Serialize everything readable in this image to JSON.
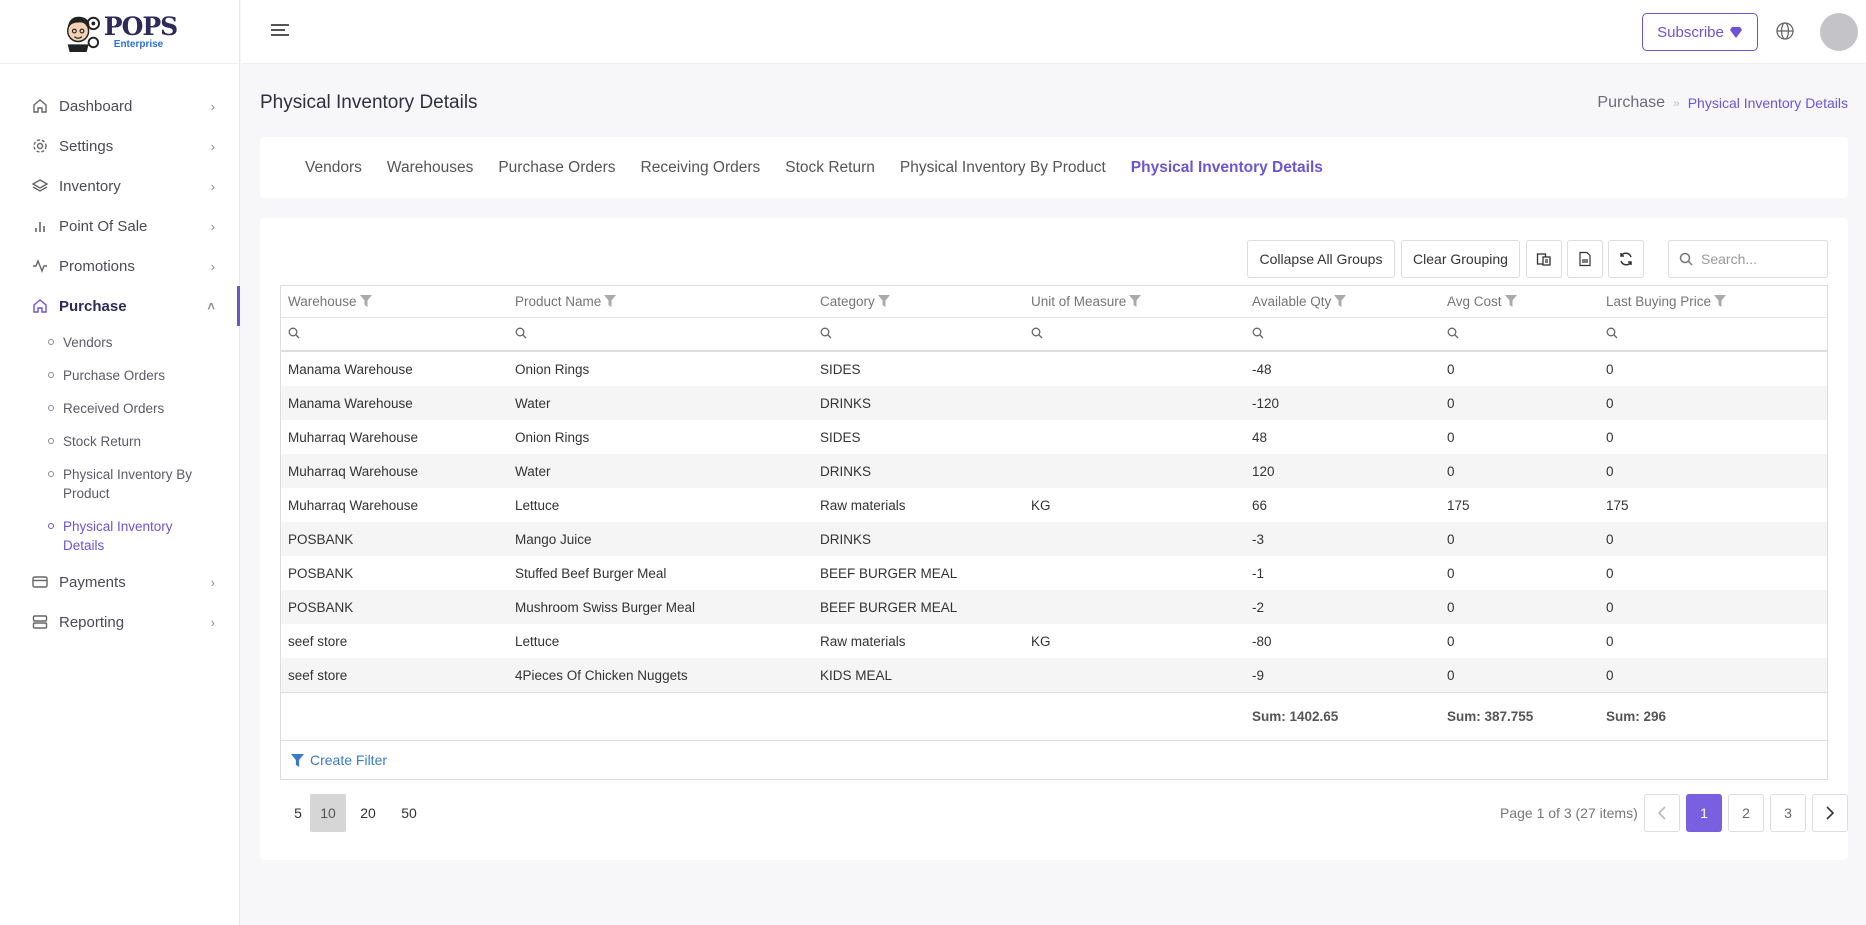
{
  "brand": {
    "name": "POPS",
    "edition": "Enterprise"
  },
  "sidebar": {
    "items": [
      {
        "label": "Dashboard",
        "icon": "home-icon"
      },
      {
        "label": "Settings",
        "icon": "gear-icon"
      },
      {
        "label": "Inventory",
        "icon": "layers-icon"
      },
      {
        "label": "Point Of Sale",
        "icon": "bar-chart-icon"
      },
      {
        "label": "Promotions",
        "icon": "activity-icon"
      },
      {
        "label": "Purchase",
        "icon": "home-icon"
      },
      {
        "label": "Payments",
        "icon": "credit-card-icon"
      },
      {
        "label": "Reporting",
        "icon": "server-icon"
      }
    ],
    "purchase_sub": [
      "Vendors",
      "Purchase Orders",
      "Received Orders",
      "Stock Return",
      "Physical Inventory By Product",
      "Physical Inventory Details"
    ]
  },
  "topbar": {
    "subscribe_label": "Subscribe"
  },
  "page": {
    "title": "Physical Inventory Details",
    "breadcrumb_root": "Purchase",
    "breadcrumb_sep": "»",
    "breadcrumb_current": "Physical Inventory Details"
  },
  "tabs": [
    "Vendors",
    "Warehouses",
    "Purchase Orders",
    "Receiving Orders",
    "Stock Return",
    "Physical Inventory By Product",
    "Physical Inventory Details"
  ],
  "toolbar": {
    "collapse_label": "Collapse All Groups",
    "clear_label": "Clear Grouping",
    "search_placeholder": "Search..."
  },
  "table": {
    "columns": [
      "Warehouse",
      "Product Name",
      "Category",
      "Unit of Measure",
      "Available Qty",
      "Avg Cost",
      "Last Buying Price"
    ],
    "rows": [
      [
        "Manama Warehouse",
        "Onion Rings",
        "SIDES",
        "",
        "-48",
        "0",
        "0"
      ],
      [
        "Manama Warehouse",
        "Water",
        "DRINKS",
        "",
        "-120",
        "0",
        "0"
      ],
      [
        "Muharraq Warehouse",
        "Onion Rings",
        "SIDES",
        "",
        "48",
        "0",
        "0"
      ],
      [
        "Muharraq Warehouse",
        "Water",
        "DRINKS",
        "",
        "120",
        "0",
        "0"
      ],
      [
        "Muharraq Warehouse",
        "Lettuce",
        "Raw materials",
        "KG",
        "66",
        "175",
        "175"
      ],
      [
        "POSBANK",
        "Mango Juice",
        "DRINKS",
        "",
        "-3",
        "0",
        "0"
      ],
      [
        "POSBANK",
        "Stuffed Beef Burger Meal",
        "BEEF BURGER MEAL",
        "",
        "-1",
        "0",
        "0"
      ],
      [
        "POSBANK",
        "Mushroom Swiss Burger Meal",
        "BEEF BURGER MEAL",
        "",
        "-2",
        "0",
        "0"
      ],
      [
        "seef store",
        "Lettuce",
        "Raw materials",
        "KG",
        "-80",
        "0",
        "0"
      ],
      [
        "seef store",
        "4Pieces Of Chicken Nuggets",
        "KIDS MEAL",
        "",
        "-9",
        "0",
        "0"
      ]
    ],
    "summary": {
      "available_qty": "Sum: 1402.65",
      "avg_cost": "Sum: 387.755",
      "last_buying_price": "Sum: 296"
    },
    "create_filter_label": "Create Filter"
  },
  "pager": {
    "sizes": [
      "5",
      "10",
      "20",
      "50"
    ],
    "selected_size": "10",
    "info": "Page 1 of 3 (27 items)",
    "pages": [
      "1",
      "2",
      "3"
    ],
    "current_page": "1"
  },
  "colors": {
    "accent": "#6a55d6",
    "link": "#3a7bc8"
  }
}
